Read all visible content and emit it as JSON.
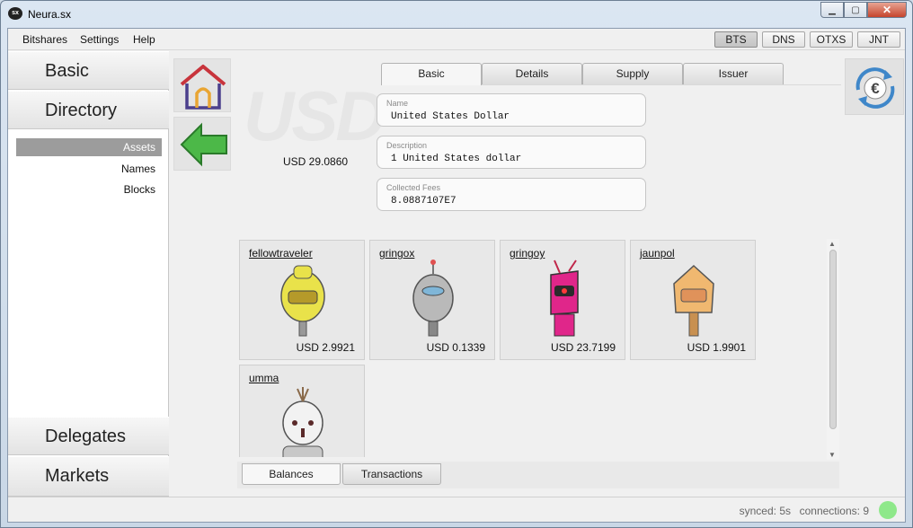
{
  "window": {
    "title": "Neura.sx",
    "icon": "app-logo-icon"
  },
  "menu": {
    "items": [
      "Bitshares",
      "Settings",
      "Help"
    ]
  },
  "chains": {
    "items": [
      "BTS",
      "DNS",
      "OTXS",
      "JNT"
    ],
    "active": "BTS"
  },
  "nav": {
    "basic": "Basic",
    "directory": "Directory",
    "sub": [
      "Assets",
      "Names",
      "Blocks"
    ],
    "sub_active": "Assets",
    "delegates": "Delegates",
    "markets": "Markets"
  },
  "asset": {
    "symbol_watermark": "USD",
    "supply": "USD 29.0860",
    "tabs": [
      "Basic",
      "Details",
      "Supply",
      "Issuer"
    ],
    "active_tab": "Basic",
    "fields": [
      {
        "label": "Name",
        "value": "United States Dollar"
      },
      {
        "label": "Description",
        "value": "1 United States dollar"
      },
      {
        "label": "Collected Fees",
        "value": "8.0887107E7"
      }
    ]
  },
  "holders": [
    {
      "name": "fellowtraveler",
      "amount": "USD 2.9921",
      "color": "#e9e24a"
    },
    {
      "name": "gringox",
      "amount": "USD 0.1339",
      "color": "#b9b9b9"
    },
    {
      "name": "gringoy",
      "amount": "USD 23.7199",
      "color": "#e0268a"
    },
    {
      "name": "jaunpol",
      "amount": "USD 1.9901",
      "color": "#f0b870"
    },
    {
      "name": "umma",
      "amount": "",
      "color": "#dedede"
    }
  ],
  "bottom_tabs": {
    "items": [
      "Balances",
      "Transactions"
    ],
    "active": "Balances"
  },
  "status": {
    "synced": "synced: 5s",
    "connections": "connections: 9",
    "online_color": "#8ee88a"
  }
}
